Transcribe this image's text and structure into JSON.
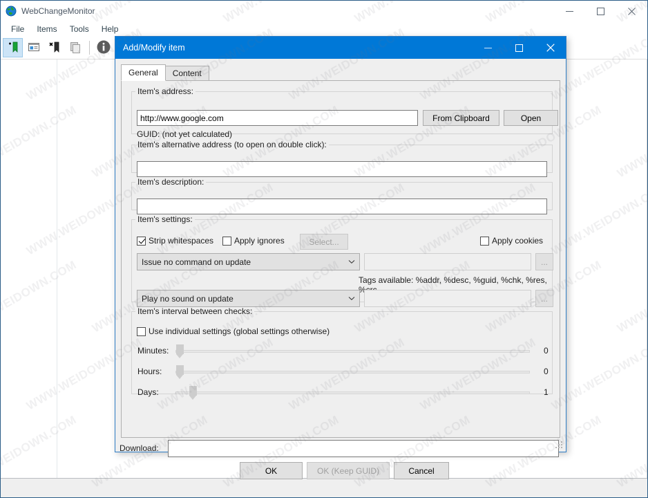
{
  "main_window": {
    "title": "WebChangeMonitor",
    "icon": "globe-icon",
    "controls": {
      "minimize": "minimize-icon",
      "maximize": "maximize-icon",
      "close": "close-icon"
    },
    "menu": [
      {
        "label": "File"
      },
      {
        "label": "Items"
      },
      {
        "label": "Tools"
      },
      {
        "label": "Help"
      }
    ],
    "toolbar": [
      {
        "name": "add-item-button",
        "icon": "add-bookmark-icon",
        "active": true
      },
      {
        "name": "edit-item-button",
        "icon": "edit-item-icon",
        "active": false
      },
      {
        "name": "delete-item-button",
        "icon": "delete-bookmark-icon",
        "active": false
      },
      {
        "name": "copy-item-button",
        "icon": "copy-icon",
        "active": false
      },
      {
        "name": "info-button",
        "icon": "info-icon",
        "active": false
      }
    ]
  },
  "dialog": {
    "title": "Add/Modify item",
    "controls": {
      "minimize": "minimize-icon",
      "maximize": "maximize-icon",
      "close": "close-icon"
    },
    "tabs": [
      {
        "label": "General",
        "selected": true
      },
      {
        "label": "Content",
        "selected": false
      }
    ],
    "address_group": {
      "legend": "Item's address:",
      "value": "http://www.google.com",
      "placeholder": "",
      "from_clipboard_label": "From Clipboard",
      "open_label": "Open",
      "guid_text": "GUID: (not yet calculated)"
    },
    "alt_address_group": {
      "legend": "Item's alternative address (to open on double click):",
      "value": "",
      "placeholder": ""
    },
    "description_group": {
      "legend": "Item's description:",
      "value": "",
      "placeholder": ""
    },
    "settings_group": {
      "legend": "Item's settings:",
      "strip_whitespaces": {
        "label": "Strip whitespaces",
        "checked": true
      },
      "apply_ignores": {
        "label": "Apply ignores",
        "checked": false
      },
      "select_button": {
        "label": "Select...",
        "disabled": true
      },
      "apply_cookies": {
        "label": "Apply cookies",
        "checked": false
      },
      "command_combo": {
        "value": "Issue no command on update"
      },
      "command_field": {
        "value": "",
        "disabled": true
      },
      "command_browse": {
        "label": "...",
        "disabled": true
      },
      "tags_text": "Tags available: %addr, %desc, %guid, %chk, %res, %crc",
      "sound_combo": {
        "value": "Play no sound on update"
      },
      "sound_field": {
        "value": "",
        "disabled": true
      },
      "sound_browse": {
        "label": "...",
        "disabled": true
      }
    },
    "interval_group": {
      "legend": "Item's interval between checks:",
      "use_individual": {
        "label": "Use individual settings (global settings otherwise)",
        "checked": false
      },
      "sliders": [
        {
          "label": "Minutes:",
          "value": "0",
          "fraction": 0.0
        },
        {
          "label": "Hours:",
          "value": "0",
          "fraction": 0.0
        },
        {
          "label": "Days:",
          "value": "1",
          "fraction": 0.038
        }
      ]
    },
    "download": {
      "label": "Download:",
      "value": "",
      "placeholder": ""
    },
    "buttons": [
      {
        "label": "OK",
        "disabled": false
      },
      {
        "label": "OK (Keep GUID)",
        "disabled": true
      },
      {
        "label": "Cancel",
        "disabled": false
      }
    ],
    "resize_grip": "resize-grip-icon"
  },
  "watermark": {
    "text": "WWW.WEIDOWN.COM"
  },
  "colors": {
    "accent": "#0078d7",
    "window_border": "#2b5c87",
    "dialog_border": "#2e7cc4",
    "dialog_bg": "#efefef"
  }
}
